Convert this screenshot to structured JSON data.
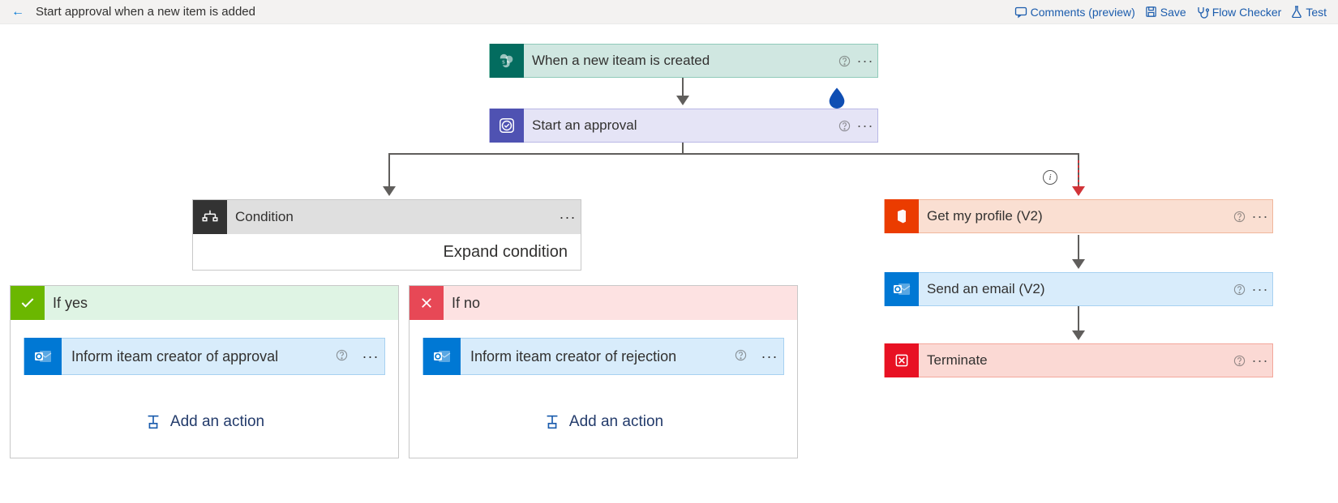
{
  "header": {
    "title": "Start approval when a new item is added",
    "buttons": {
      "comments": "Comments (preview)",
      "save": "Save",
      "checker": "Flow Checker",
      "test": "Test"
    }
  },
  "cards": {
    "trigger": "When a new iteam is created",
    "approval": "Start an approval",
    "condition": "Condition",
    "expand": "Expand condition",
    "ifyes": "If yes",
    "ifno": "If no",
    "yesAction": "Inform iteam creator of approval",
    "noAction": "Inform iteam creator of rejection",
    "addAction": "Add an action",
    "profile": "Get my profile (V2)",
    "email": "Send an email (V2)",
    "terminate": "Terminate"
  }
}
